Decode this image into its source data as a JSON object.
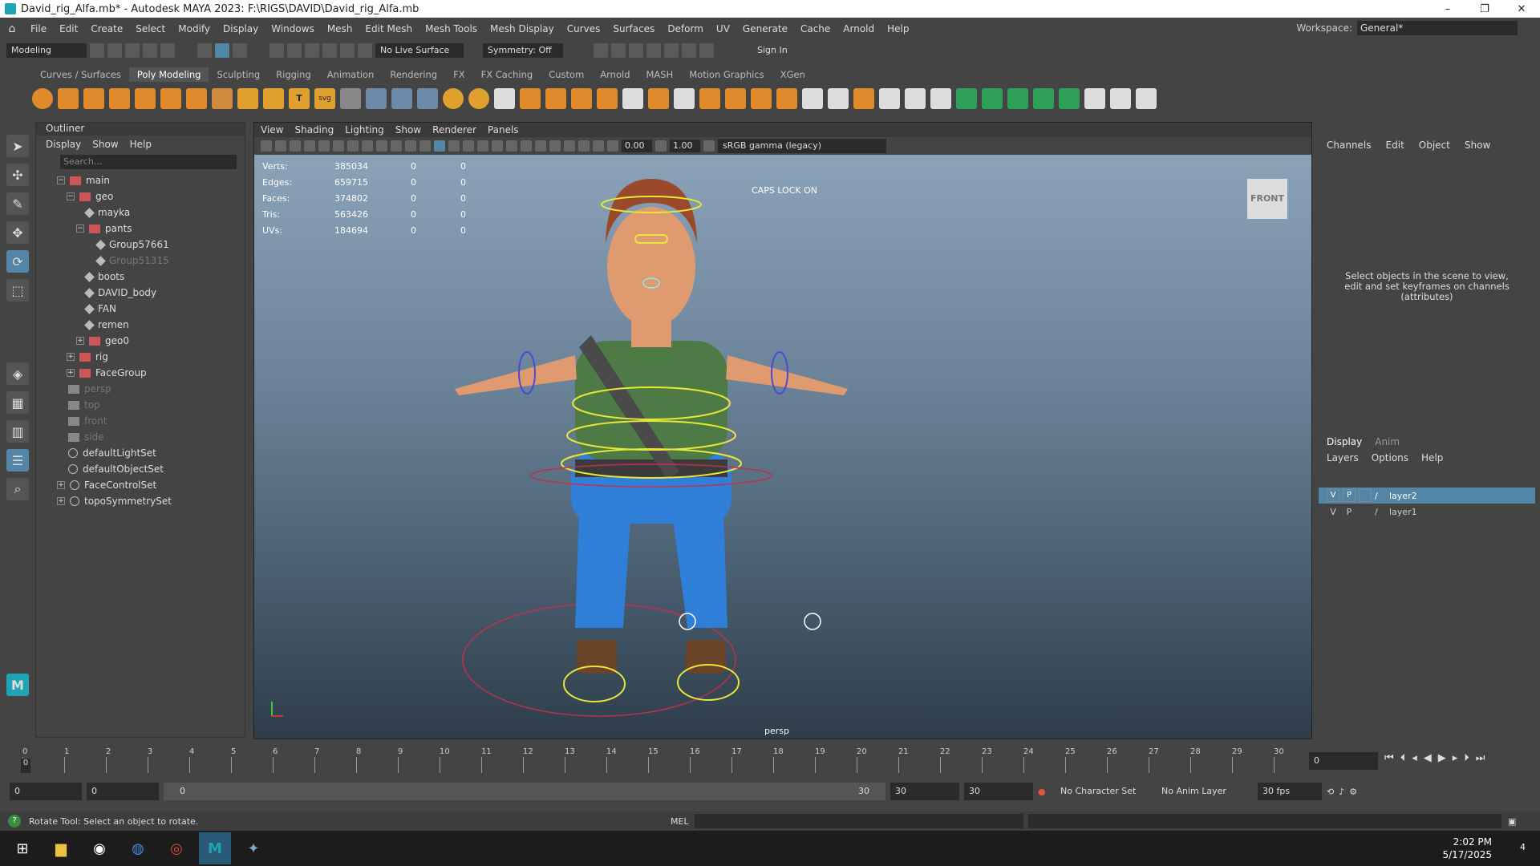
{
  "window": {
    "title": "David_rig_Alfa.mb* - Autodesk MAYA 2023: F:\\RIGS\\DAVID\\David_rig_Alfa.mb",
    "minimize": "–",
    "restore": "❐",
    "close": "✕"
  },
  "menubar": [
    "File",
    "Edit",
    "Create",
    "Select",
    "Modify",
    "Display",
    "Windows",
    "Mesh",
    "Edit Mesh",
    "Mesh Tools",
    "Mesh Display",
    "Curves",
    "Surfaces",
    "Deform",
    "UV",
    "Generate",
    "Cache",
    "Arnold",
    "Help"
  ],
  "workspace": {
    "label": "Workspace:",
    "value": "General*"
  },
  "statusline": {
    "mode": "Modeling",
    "live_surface": "No Live Surface",
    "symmetry": "Symmetry: Off",
    "sign_in": "Sign In"
  },
  "shelf_tabs": [
    "Curves / Surfaces",
    "Poly Modeling",
    "Sculpting",
    "Rigging",
    "Animation",
    "Rendering",
    "FX",
    "FX Caching",
    "Custom",
    "Arnold",
    "MASH",
    "Motion Graphics",
    "XGen"
  ],
  "shelf_active": "Poly Modeling",
  "outliner": {
    "title": "Outliner",
    "menu": [
      "Display",
      "Show",
      "Help"
    ],
    "search_placeholder": "Search...",
    "items": [
      {
        "label": "main",
        "icon": "transform-icon"
      },
      {
        "label": "geo",
        "icon": "transform-icon"
      },
      {
        "label": "mayka",
        "icon": "mesh-icon"
      },
      {
        "label": "pants",
        "icon": "transform-icon"
      },
      {
        "label": "Group57661",
        "icon": "mesh-icon"
      },
      {
        "label": "Group51315",
        "icon": "mesh-icon",
        "dim": true
      },
      {
        "label": "boots",
        "icon": "mesh-icon"
      },
      {
        "label": "DAVID_body",
        "icon": "mesh-icon"
      },
      {
        "label": "FAN",
        "icon": "mesh-icon"
      },
      {
        "label": "remen",
        "icon": "mesh-icon"
      },
      {
        "label": "geo0",
        "icon": "transform-icon"
      },
      {
        "label": "rig",
        "icon": "transform-icon"
      },
      {
        "label": "FaceGroup",
        "icon": "transform-icon"
      },
      {
        "label": "persp",
        "icon": "camera-icon",
        "dim": true
      },
      {
        "label": "top",
        "icon": "camera-icon",
        "dim": true
      },
      {
        "label": "front",
        "icon": "camera-icon",
        "dim": true
      },
      {
        "label": "side",
        "icon": "camera-icon",
        "dim": true
      },
      {
        "label": "defaultLightSet",
        "icon": "set-icon"
      },
      {
        "label": "defaultObjectSet",
        "icon": "set-icon"
      },
      {
        "label": "FaceControlSet",
        "icon": "set-icon"
      },
      {
        "label": "topoSymmetrySet",
        "icon": "set-icon"
      }
    ]
  },
  "viewport": {
    "menu": [
      "View",
      "Shading",
      "Lighting",
      "Show",
      "Renderer",
      "Panels"
    ],
    "exposure": "0.00",
    "gamma": "1.00",
    "color_space": "sRGB gamma (legacy)",
    "caps_lock": "CAPS LOCK ON",
    "view_cube": "FRONT",
    "camera": "persp",
    "hud": [
      {
        "label": "Verts:",
        "v": "385034",
        "a": "0",
        "b": "0"
      },
      {
        "label": "Edges:",
        "v": "659715",
        "a": "0",
        "b": "0"
      },
      {
        "label": "Faces:",
        "v": "374802",
        "a": "0",
        "b": "0"
      },
      {
        "label": "Tris:",
        "v": "563426",
        "a": "0",
        "b": "0"
      },
      {
        "label": "UVs:",
        "v": "184694",
        "a": "0",
        "b": "0"
      }
    ]
  },
  "channel_box": {
    "tabs": [
      "Channels",
      "Edit",
      "Object",
      "Show"
    ],
    "message": "Select objects in the scene to view, edit and set keyframes on channels (attributes)"
  },
  "layer_editor": {
    "tabs": [
      "Display",
      "Anim"
    ],
    "menu": [
      "Layers",
      "Options",
      "Help"
    ],
    "layers": [
      {
        "v": "V",
        "p": "P",
        "name": "layer2",
        "selected": true
      },
      {
        "v": "V",
        "p": "P",
        "name": "layer1",
        "selected": false
      }
    ]
  },
  "timeline": {
    "ticks": [
      "0",
      "1",
      "2",
      "3",
      "4",
      "5",
      "6",
      "7",
      "8",
      "9",
      "10",
      "11",
      "12",
      "13",
      "14",
      "15",
      "16",
      "17",
      "18",
      "19",
      "20",
      "21",
      "22",
      "23",
      "24",
      "25",
      "26",
      "27",
      "28",
      "29",
      "30"
    ],
    "current": "0",
    "current_frame_field": "0"
  },
  "range": {
    "start": "0",
    "playback_start": "0",
    "slider_start": "0",
    "slider_end": "30",
    "playback_end": "30",
    "end": "30",
    "character_set": "No Character Set",
    "anim_layer": "No Anim Layer",
    "fps": "30 fps"
  },
  "helpline": {
    "text": "Rotate Tool: Select an object to rotate.",
    "mel": "MEL"
  },
  "taskbar": {
    "time": "2:02 PM",
    "date": "5/17/2025",
    "notifications": "4"
  }
}
